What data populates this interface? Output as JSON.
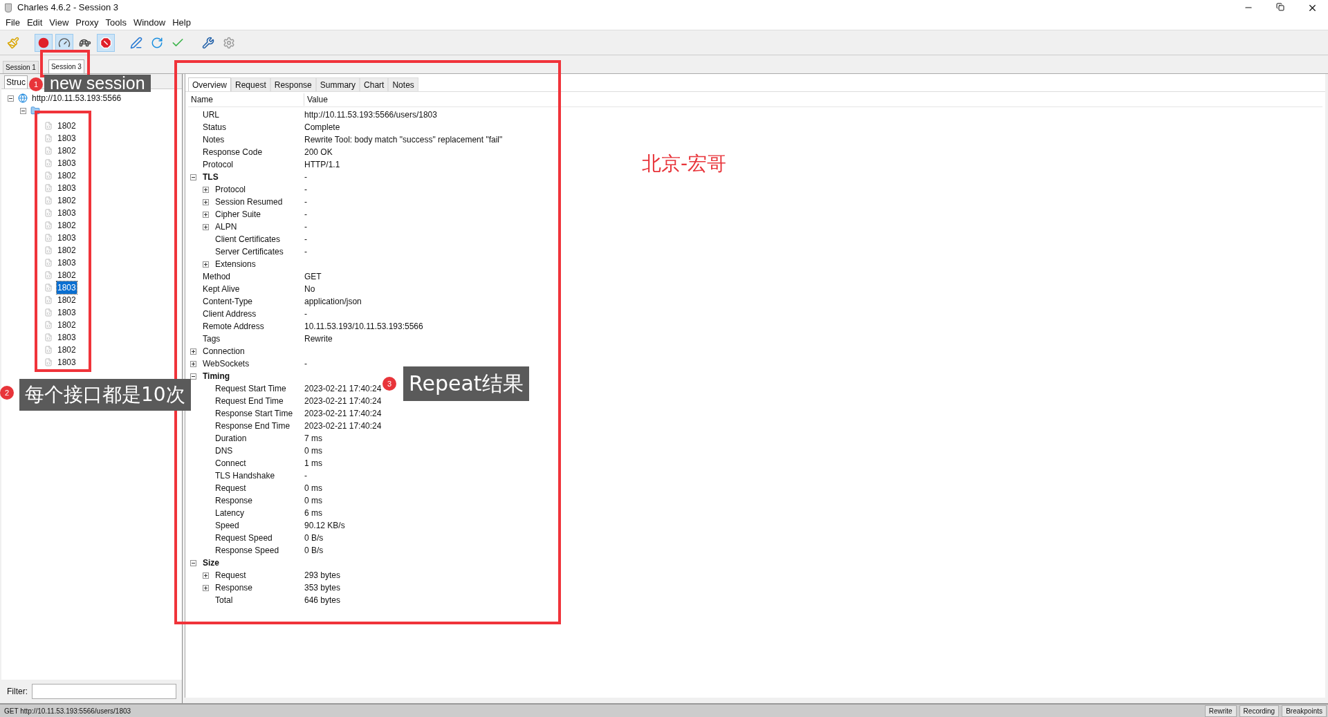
{
  "window": {
    "title": "Charles 4.6.2 - Session 3"
  },
  "menu": [
    "File",
    "Edit",
    "View",
    "Proxy",
    "Tools",
    "Window",
    "Help"
  ],
  "toolbar": [
    {
      "kind": "broom",
      "pressed": false
    },
    {
      "kind": "record",
      "pressed": true
    },
    {
      "kind": "throttle",
      "pressed": true
    },
    {
      "kind": "turtle",
      "pressed": false
    },
    {
      "kind": "breakpoint",
      "pressed": true
    },
    {
      "kind": "pen",
      "pressed": false
    },
    {
      "kind": "refresh",
      "pressed": false
    },
    {
      "kind": "check",
      "pressed": false
    },
    {
      "kind": "tools",
      "pressed": false
    },
    {
      "kind": "gear",
      "pressed": false
    }
  ],
  "session_tabs": [
    {
      "label": "Session 1",
      "selected": false
    },
    {
      "label": "Session 3",
      "selected": true
    }
  ],
  "left_panel": {
    "view_tab": "Struc",
    "host": {
      "label": "http://10.11.53.193:5566",
      "expanded": true
    },
    "folder": {
      "expanded": true
    },
    "items": [
      {
        "label": "1802",
        "selected": false
      },
      {
        "label": "1803",
        "selected": false
      },
      {
        "label": "1802",
        "selected": false
      },
      {
        "label": "1803",
        "selected": false
      },
      {
        "label": "1802",
        "selected": false
      },
      {
        "label": "1803",
        "selected": false
      },
      {
        "label": "1802",
        "selected": false
      },
      {
        "label": "1803",
        "selected": false
      },
      {
        "label": "1802",
        "selected": false
      },
      {
        "label": "1803",
        "selected": false
      },
      {
        "label": "1802",
        "selected": false
      },
      {
        "label": "1803",
        "selected": false
      },
      {
        "label": "1802",
        "selected": false
      },
      {
        "label": "1803",
        "selected": true
      },
      {
        "label": "1802",
        "selected": false
      },
      {
        "label": "1803",
        "selected": false
      },
      {
        "label": "1802",
        "selected": false
      },
      {
        "label": "1803",
        "selected": false
      },
      {
        "label": "1802",
        "selected": false
      },
      {
        "label": "1803",
        "selected": false
      }
    ],
    "filter_label": "Filter:"
  },
  "detail_tabs": [
    {
      "label": "Overview",
      "selected": true
    },
    {
      "label": "Request",
      "selected": false
    },
    {
      "label": "Response",
      "selected": false
    },
    {
      "label": "Summary",
      "selected": false
    },
    {
      "label": "Chart",
      "selected": false
    },
    {
      "label": "Notes",
      "selected": false
    }
  ],
  "columns": [
    "Name",
    "Value"
  ],
  "rows": [
    {
      "kind": "leaf",
      "name": "URL",
      "value": "http://10.11.53.193:5566/users/1803"
    },
    {
      "kind": "leaf",
      "name": "Status",
      "value": "Complete"
    },
    {
      "kind": "leaf",
      "name": "Notes",
      "value": "Rewrite Tool: body match \"success\" replacement \"fail\""
    },
    {
      "kind": "leaf",
      "name": "Response Code",
      "value": "200 OK"
    },
    {
      "kind": "leaf",
      "name": "Protocol",
      "value": "HTTP/1.1"
    },
    {
      "kind": "group",
      "name": "TLS",
      "value": "-",
      "expanded": true,
      "children": [
        {
          "kind": "group",
          "name": "Protocol",
          "value": "-",
          "expanded": false
        },
        {
          "kind": "group",
          "name": "Session Resumed",
          "value": "-",
          "expanded": false
        },
        {
          "kind": "group",
          "name": "Cipher Suite",
          "value": "-",
          "expanded": false
        },
        {
          "kind": "group",
          "name": "ALPN",
          "value": "-",
          "expanded": false
        },
        {
          "kind": "leaf",
          "name": "Client Certificates",
          "value": "-"
        },
        {
          "kind": "leaf",
          "name": "Server Certificates",
          "value": "-"
        },
        {
          "kind": "group",
          "name": "Extensions",
          "expanded": false
        }
      ]
    },
    {
      "kind": "leaf",
      "name": "Method",
      "value": "GET"
    },
    {
      "kind": "leaf",
      "name": "Kept Alive",
      "value": "No"
    },
    {
      "kind": "leaf",
      "name": "Content-Type",
      "value": "application/json"
    },
    {
      "kind": "leaf",
      "name": "Client Address",
      "value": "-"
    },
    {
      "kind": "leaf",
      "name": "Remote Address",
      "value": "10.11.53.193/10.11.53.193:5566"
    },
    {
      "kind": "leaf",
      "name": "Tags",
      "value": "Rewrite"
    },
    {
      "kind": "group",
      "name": "Connection",
      "expanded": false
    },
    {
      "kind": "group",
      "name": "WebSockets",
      "value": "-",
      "expanded": false
    },
    {
      "kind": "group",
      "name": "Timing",
      "expanded": true,
      "children": [
        {
          "kind": "leaf",
          "name": "Request Start Time",
          "value": "2023-02-21 17:40:24"
        },
        {
          "kind": "leaf",
          "name": "Request End Time",
          "value": "2023-02-21 17:40:24"
        },
        {
          "kind": "leaf",
          "name": "Response Start Time",
          "value": "2023-02-21 17:40:24"
        },
        {
          "kind": "leaf",
          "name": "Response End Time",
          "value": "2023-02-21 17:40:24"
        },
        {
          "kind": "leaf",
          "name": "Duration",
          "value": "7 ms"
        },
        {
          "kind": "leaf",
          "name": "DNS",
          "value": "0 ms"
        },
        {
          "kind": "leaf",
          "name": "Connect",
          "value": "1 ms"
        },
        {
          "kind": "leaf",
          "name": "TLS Handshake",
          "value": "-"
        },
        {
          "kind": "leaf",
          "name": "Request",
          "value": "0 ms"
        },
        {
          "kind": "leaf",
          "name": "Response",
          "value": "0 ms"
        },
        {
          "kind": "leaf",
          "name": "Latency",
          "value": "6 ms"
        },
        {
          "kind": "leaf",
          "name": "Speed",
          "value": "90.12 KB/s"
        },
        {
          "kind": "leaf",
          "name": "Request Speed",
          "value": "0 B/s"
        },
        {
          "kind": "leaf",
          "name": "Response Speed",
          "value": "0 B/s"
        }
      ]
    },
    {
      "kind": "group",
      "name": "Size",
      "expanded": true,
      "children": [
        {
          "kind": "group",
          "name": "Request",
          "value": "293 bytes",
          "expanded": false
        },
        {
          "kind": "group",
          "name": "Response",
          "value": "353 bytes",
          "expanded": false
        },
        {
          "kind": "leaf",
          "name": "Total",
          "value": "646 bytes"
        }
      ]
    }
  ],
  "status_bar": {
    "text": "GET http://10.11.53.193:5566/users/1803",
    "buttons": [
      "Rewrite",
      "Recording",
      "Breakpoints"
    ]
  },
  "annotations": {
    "callouts": [
      {
        "number": "1",
        "text": "new session"
      },
      {
        "number": "2",
        "text": "每个接口都是10次"
      },
      {
        "number": "3",
        "text": "Repeat结果"
      }
    ],
    "red_label": "北京-宏哥"
  }
}
